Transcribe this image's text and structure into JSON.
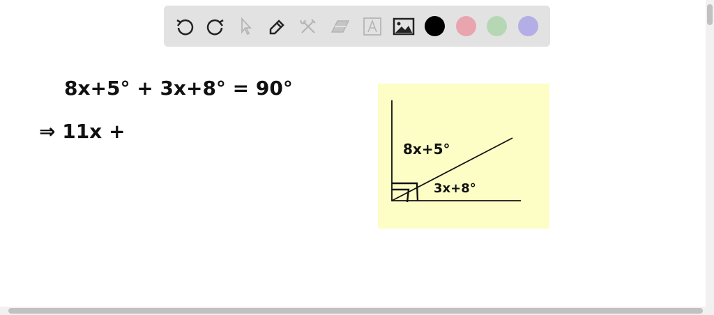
{
  "toolbar": {
    "tools": [
      "undo-icon",
      "redo-icon",
      "select-icon",
      "pen-icon",
      "tools-icon",
      "eraser-icon",
      "text-icon",
      "image-icon"
    ],
    "colors": [
      "#000000",
      "#e8a5ad",
      "#b6d7b4",
      "#b4aee6"
    ]
  },
  "canvas": {
    "equation_line1": "8x+5° + 3x+8° = 90°",
    "equation_line2": "⇒  11x +",
    "diagram": {
      "angle_top_label": "8x+5°",
      "angle_bottom_label": "3x+8°",
      "background": "#fdfdc6"
    }
  }
}
